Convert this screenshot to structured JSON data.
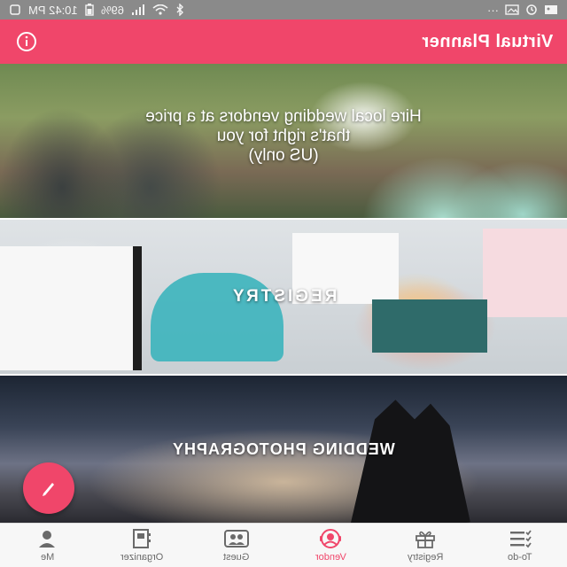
{
  "status_bar": {
    "time": "10:42 PM",
    "battery": "69%",
    "overflow": "···"
  },
  "app_bar": {
    "title": "Virtual Planner",
    "info_icon": "info-icon"
  },
  "banners": [
    {
      "text_lines": [
        "Hire local wedding vendors at a price",
        "that's right for you",
        "(US only)"
      ]
    },
    {
      "text": "REGISTRY"
    },
    {
      "text": "WEDDING PHOTOGRAPHY"
    }
  ],
  "fab": {
    "icon": "pencil-icon"
  },
  "bottom_nav": [
    {
      "label": "To-do",
      "icon": "checklist-icon"
    },
    {
      "label": "Registry",
      "icon": "gift-icon"
    },
    {
      "label": "Vendor",
      "icon": "vendor-icon",
      "active": true
    },
    {
      "label": "Guest",
      "icon": "guest-icon"
    },
    {
      "label": "Organizer",
      "icon": "organizer-icon"
    },
    {
      "label": "Me",
      "icon": "person-icon"
    }
  ],
  "colors": {
    "accent": "#f0466a",
    "nav_inactive": "#6a6a6a",
    "status_bar": "#8a8a8a"
  }
}
